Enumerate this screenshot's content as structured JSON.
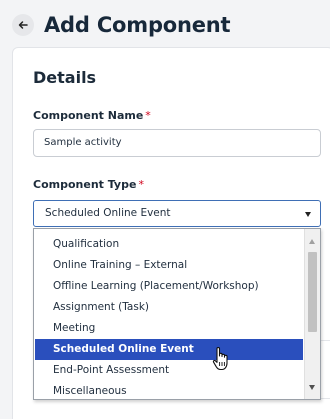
{
  "header": {
    "back_icon": "arrow-left-icon",
    "title": "Add Component"
  },
  "details": {
    "section_title": "Details",
    "component_name": {
      "label": "Component Name",
      "required_mark": "*",
      "value": "Sample activity"
    },
    "component_type": {
      "label": "Component Type",
      "required_mark": "*",
      "selected_value": "Scheduled Online Event",
      "caret_icon": "caret-down-icon",
      "options": [
        "Qualification",
        "Online Training – External",
        "Offline Learning (Placement/Workshop)",
        "Assignment (Task)",
        "Meeting",
        "Scheduled Online Event",
        "End-Point Assessment",
        "Miscellaneous"
      ],
      "highlighted_index": 5
    }
  },
  "colors": {
    "highlight": "#2a4fbd",
    "required": "#d0021b",
    "focus_border": "#3f6fb5"
  },
  "pointer": "hand-pointer-icon"
}
